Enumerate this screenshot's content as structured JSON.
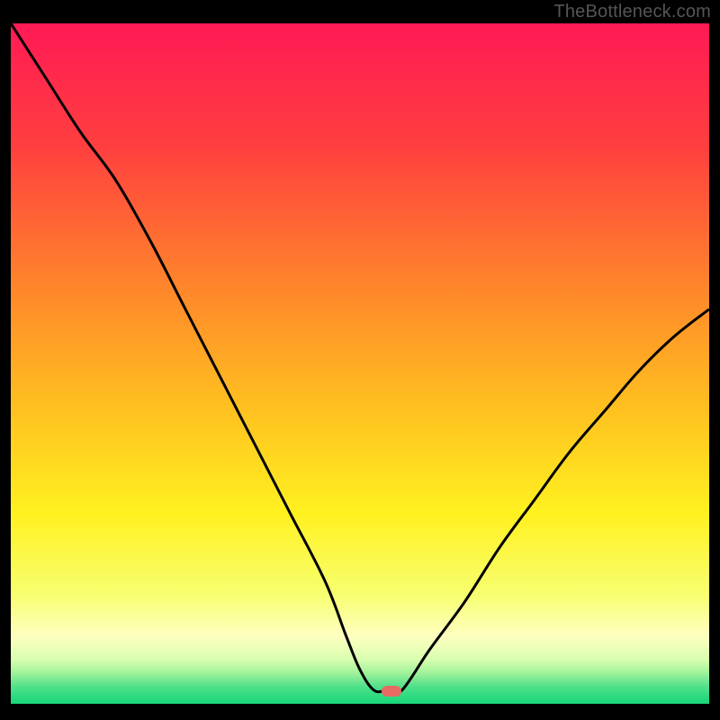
{
  "watermark": {
    "text": "TheBottleneck.com"
  },
  "marker": {
    "name": "bottleneck-point",
    "color": "#e86a63",
    "left_pct": 54.5,
    "top_pct": 98.2
  },
  "chart_data": {
    "type": "line",
    "title": "",
    "xlabel": "",
    "ylabel": "",
    "xlim": [
      0,
      100
    ],
    "ylim": [
      0,
      100
    ],
    "note": "y=100 is top (worst / red), y=0 is bottom (best / green). Curve is bottleneck % vs component balance.",
    "series": [
      {
        "name": "bottleneck-curve",
        "x": [
          0,
          5,
          10,
          15,
          20,
          25,
          30,
          35,
          40,
          45,
          48,
          50,
          52,
          54,
          56,
          60,
          65,
          70,
          75,
          80,
          85,
          90,
          95,
          100
        ],
        "y": [
          100,
          92,
          84,
          77,
          68,
          58,
          48,
          38,
          28,
          18,
          10,
          5,
          2,
          2,
          2,
          8,
          15,
          23,
          30,
          37,
          43,
          49,
          54,
          58
        ]
      }
    ],
    "gradient_stops": [
      {
        "offset": 0.0,
        "color": "#ff1a55"
      },
      {
        "offset": 0.18,
        "color": "#ff3f3f"
      },
      {
        "offset": 0.4,
        "color": "#ff8a2a"
      },
      {
        "offset": 0.58,
        "color": "#ffc51f"
      },
      {
        "offset": 0.72,
        "color": "#fff120"
      },
      {
        "offset": 0.84,
        "color": "#f7ff70"
      },
      {
        "offset": 0.9,
        "color": "#ffffc0"
      },
      {
        "offset": 0.935,
        "color": "#d8ffb0"
      },
      {
        "offset": 0.955,
        "color": "#9ff29a"
      },
      {
        "offset": 0.975,
        "color": "#4fe08a"
      },
      {
        "offset": 1.0,
        "color": "#17d67a"
      }
    ],
    "curve_color": "#000000",
    "grid": false,
    "legend": false
  }
}
